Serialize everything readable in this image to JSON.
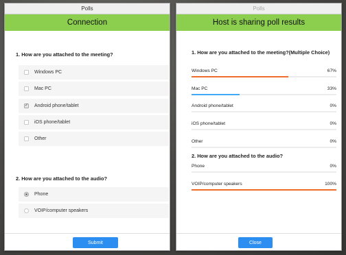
{
  "vote_window": {
    "title": "Polls",
    "header": "Connection",
    "question1": "1. How are you attached to the meeting?",
    "q1_options": [
      {
        "label": "Windows PC",
        "checked": false
      },
      {
        "label": "Mac PC",
        "checked": false
      },
      {
        "label": "Android phone/tablet",
        "checked": true
      },
      {
        "label": "iOS phone/tablet",
        "checked": false
      },
      {
        "label": "Other",
        "checked": false
      }
    ],
    "question2": "2. How are you attached to the audio?",
    "q2_options": [
      {
        "label": "Phone",
        "selected": true
      },
      {
        "label": "VOIP/computer speakers",
        "selected": false
      }
    ],
    "submit_label": "Submit"
  },
  "results_window": {
    "title": "Polls",
    "header": "Host is sharing poll results",
    "question1": "1. How are you attached to the meeting?(Multiple Choice)",
    "q1_results": [
      {
        "label": "Windows PC",
        "percent": "67%",
        "value": 67
      },
      {
        "label": "Mac PC",
        "percent": "33%",
        "value": 33
      },
      {
        "label": "Android phone/tablet",
        "percent": "0%",
        "value": 0
      },
      {
        "label": "iOS phone/tablet",
        "percent": "0%",
        "value": 0
      },
      {
        "label": "Other",
        "percent": "0%",
        "value": 0
      }
    ],
    "question2": "2. How are you attached to the audio?",
    "q2_results": [
      {
        "label": "Phone",
        "percent": "0%",
        "value": 0
      },
      {
        "label": "VOIP/computer speakers",
        "percent": "100%",
        "value": 100
      }
    ],
    "close_label": "Close"
  },
  "colors": {
    "header_green": "#8ccf4f",
    "button_blue": "#2d8ef2",
    "bar_orange": "#f06a2a",
    "bar_blue": "#3fa9f5"
  }
}
